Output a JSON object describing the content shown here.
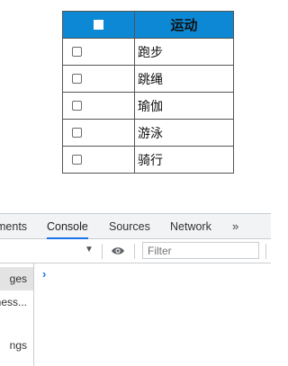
{
  "table": {
    "header": {
      "label": "运动"
    },
    "rows": [
      {
        "label": "跑步"
      },
      {
        "label": "跳绳"
      },
      {
        "label": "瑜伽"
      },
      {
        "label": "游泳"
      },
      {
        "label": "骑行"
      }
    ]
  },
  "devtools": {
    "tabs": [
      {
        "label": "ments"
      },
      {
        "label": "Console"
      },
      {
        "label": "Sources"
      },
      {
        "label": "Network"
      }
    ],
    "more_label": "»",
    "filter_placeholder": "Filter",
    "sidebar": [
      {
        "label": "ges"
      },
      {
        "label": "ness..."
      },
      {
        "label": "ngs"
      }
    ],
    "prompt_symbol": "›",
    "accent_color": "#1a73e8"
  },
  "colors": {
    "table_header_bg": "#0c88d4"
  }
}
